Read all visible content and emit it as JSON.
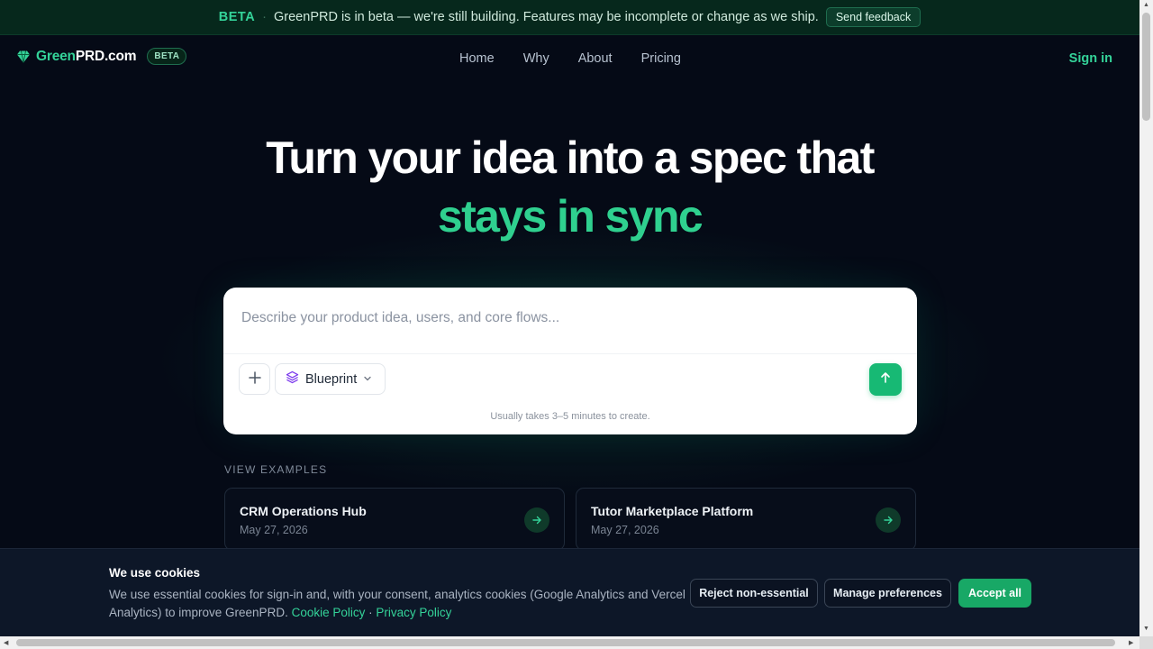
{
  "banner": {
    "tag": "BETA",
    "separator": "·",
    "message": "GreenPRD is in beta — we're still building. Features may be incomplete or change as we ship.",
    "feedback_label": "Send feedback"
  },
  "nav": {
    "logo_green": "Green",
    "logo_white": "PRD.com",
    "logo_badge": "BETA",
    "items": [
      "Home",
      "Why",
      "About",
      "Pricing"
    ],
    "sign_in": "Sign in"
  },
  "hero": {
    "line1": "Turn your idea into a spec that",
    "line2": "stays in sync"
  },
  "prompt": {
    "placeholder": "Describe your product idea, users, and core flows...",
    "mode_label": "Blueprint",
    "hint": "Usually takes 3–5 minutes to create."
  },
  "examples": {
    "label": "VIEW EXAMPLES",
    "items": [
      {
        "title": "CRM Operations Hub",
        "date": "May 27, 2026"
      },
      {
        "title": "Tutor Marketplace Platform",
        "date": "May 27, 2026"
      }
    ]
  },
  "cookie": {
    "title": "We use cookies",
    "body": "We use essential cookies for sign-in and, with your consent, analytics cookies (Google Analytics and Vercel Analytics) to improve GreenPRD. ",
    "policy_link": "Cookie Policy",
    "link_separator": " · ",
    "privacy_link": "Privacy Policy",
    "reject_label": "Reject non-essential",
    "manage_label": "Manage preferences",
    "accept_label": "Accept all"
  },
  "colors": {
    "brand_green": "#34d399",
    "send_button": "#17b974",
    "background": "#050a16"
  },
  "icons": {
    "logo": "gem-icon",
    "add": "plus-icon",
    "mode": "layers-icon",
    "dropdown": "chevron-down-icon",
    "submit": "arrow-up-icon",
    "card_open": "arrow-right-icon"
  }
}
